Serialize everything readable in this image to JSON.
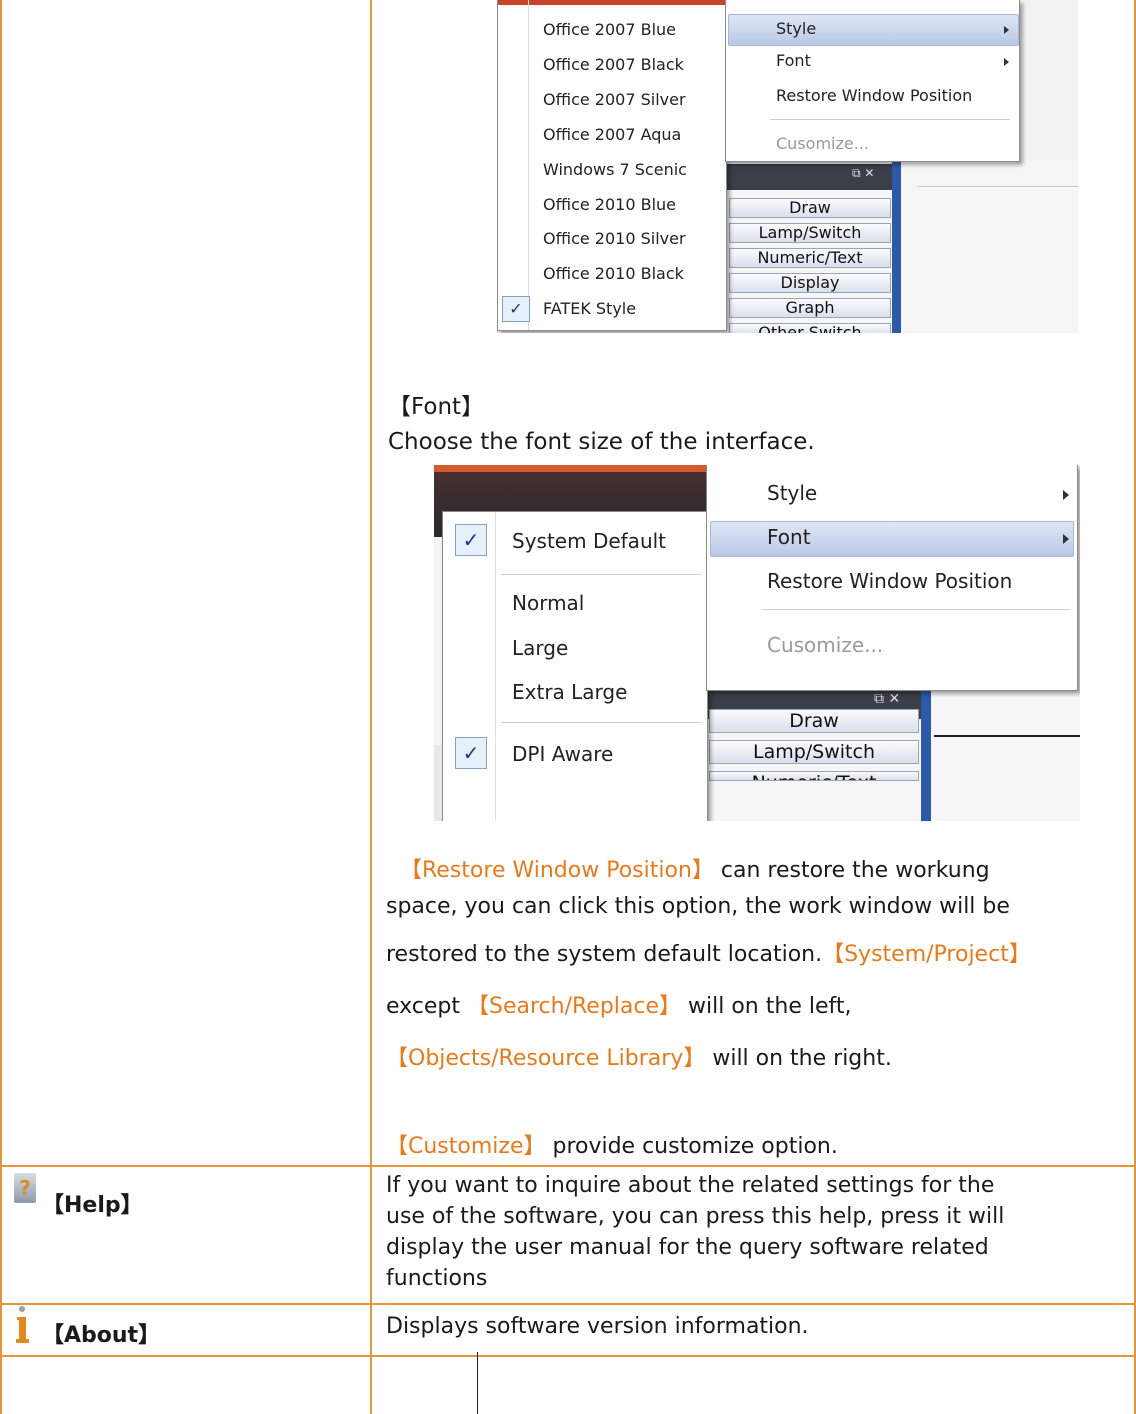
{
  "style_menu_shot": {
    "styles": [
      "Office 2007 Blue",
      "Office 2007 Black",
      "Office 2007 Silver",
      "Office 2007 Aqua",
      "Windows 7 Scenic",
      "Office 2010 Blue",
      "Office 2010 Silver",
      "Office 2010 Black",
      "FATEK Style"
    ],
    "check_mark": "✓",
    "submenu": [
      "Style",
      "Font",
      "Restore Window Position",
      "Cusomize..."
    ],
    "categories": [
      "Draw",
      "Lamp/Switch",
      "Numeric/Text",
      "Display",
      "Graph",
      "Other Switch"
    ],
    "panel_glyph": "⧉ ✕"
  },
  "font_section": {
    "heading": "【Font】",
    "description": "Choose the font size of the interface."
  },
  "font_menu_shot": {
    "options": [
      "System Default",
      "Normal",
      "Large",
      "Extra Large",
      "DPI Aware"
    ],
    "check_mark": "✓",
    "submenu": [
      "Style",
      "Font",
      "Restore Window Position",
      "Cusomize..."
    ],
    "categories": [
      "Draw",
      "Lamp/Switch",
      "Numeric/Text"
    ],
    "panel_glyph": "⧉ ✕"
  },
  "restore_paragraph": {
    "term1": "【Restore Window Position】",
    "line1_rest": " can restore the workung",
    "line2": "space, you can click this option, the work window will be",
    "line3_text": "restored to the system default location.",
    "term2": "【System/Project】",
    "line4_pre": "except ",
    "term3": "【Search/Replace】",
    "line4_post": " will on the left,",
    "term4": "【Objects/Resource Library】",
    "line5_post": " will on the right."
  },
  "customize_paragraph": {
    "term": "【Customize】",
    "rest": " provide customize option."
  },
  "help_row": {
    "label": "【Help】",
    "lines": [
      "If you want to inquire about the related settings for the",
      "use of the software, you can press this help, press it will",
      "display the user manual for the query software related",
      "functions"
    ]
  },
  "about_row": {
    "label": "【About】",
    "text": "Displays software version information."
  }
}
